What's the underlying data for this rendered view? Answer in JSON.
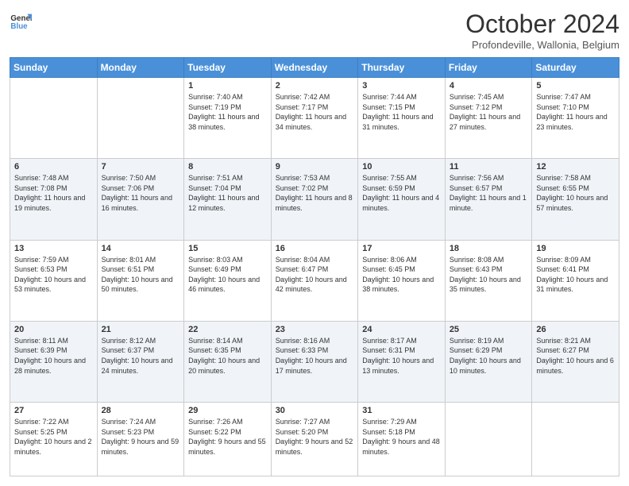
{
  "logo": {
    "text1": "General",
    "text2": "Blue"
  },
  "header": {
    "title": "October 2024",
    "subtitle": "Profondeville, Wallonia, Belgium"
  },
  "days_of_week": [
    "Sunday",
    "Monday",
    "Tuesday",
    "Wednesday",
    "Thursday",
    "Friday",
    "Saturday"
  ],
  "weeks": [
    [
      {
        "day": "",
        "info": ""
      },
      {
        "day": "",
        "info": ""
      },
      {
        "day": "1",
        "info": "Sunrise: 7:40 AM\nSunset: 7:19 PM\nDaylight: 11 hours and 38 minutes."
      },
      {
        "day": "2",
        "info": "Sunrise: 7:42 AM\nSunset: 7:17 PM\nDaylight: 11 hours and 34 minutes."
      },
      {
        "day": "3",
        "info": "Sunrise: 7:44 AM\nSunset: 7:15 PM\nDaylight: 11 hours and 31 minutes."
      },
      {
        "day": "4",
        "info": "Sunrise: 7:45 AM\nSunset: 7:12 PM\nDaylight: 11 hours and 27 minutes."
      },
      {
        "day": "5",
        "info": "Sunrise: 7:47 AM\nSunset: 7:10 PM\nDaylight: 11 hours and 23 minutes."
      }
    ],
    [
      {
        "day": "6",
        "info": "Sunrise: 7:48 AM\nSunset: 7:08 PM\nDaylight: 11 hours and 19 minutes."
      },
      {
        "day": "7",
        "info": "Sunrise: 7:50 AM\nSunset: 7:06 PM\nDaylight: 11 hours and 16 minutes."
      },
      {
        "day": "8",
        "info": "Sunrise: 7:51 AM\nSunset: 7:04 PM\nDaylight: 11 hours and 12 minutes."
      },
      {
        "day": "9",
        "info": "Sunrise: 7:53 AM\nSunset: 7:02 PM\nDaylight: 11 hours and 8 minutes."
      },
      {
        "day": "10",
        "info": "Sunrise: 7:55 AM\nSunset: 6:59 PM\nDaylight: 11 hours and 4 minutes."
      },
      {
        "day": "11",
        "info": "Sunrise: 7:56 AM\nSunset: 6:57 PM\nDaylight: 11 hours and 1 minute."
      },
      {
        "day": "12",
        "info": "Sunrise: 7:58 AM\nSunset: 6:55 PM\nDaylight: 10 hours and 57 minutes."
      }
    ],
    [
      {
        "day": "13",
        "info": "Sunrise: 7:59 AM\nSunset: 6:53 PM\nDaylight: 10 hours and 53 minutes."
      },
      {
        "day": "14",
        "info": "Sunrise: 8:01 AM\nSunset: 6:51 PM\nDaylight: 10 hours and 50 minutes."
      },
      {
        "day": "15",
        "info": "Sunrise: 8:03 AM\nSunset: 6:49 PM\nDaylight: 10 hours and 46 minutes."
      },
      {
        "day": "16",
        "info": "Sunrise: 8:04 AM\nSunset: 6:47 PM\nDaylight: 10 hours and 42 minutes."
      },
      {
        "day": "17",
        "info": "Sunrise: 8:06 AM\nSunset: 6:45 PM\nDaylight: 10 hours and 38 minutes."
      },
      {
        "day": "18",
        "info": "Sunrise: 8:08 AM\nSunset: 6:43 PM\nDaylight: 10 hours and 35 minutes."
      },
      {
        "day": "19",
        "info": "Sunrise: 8:09 AM\nSunset: 6:41 PM\nDaylight: 10 hours and 31 minutes."
      }
    ],
    [
      {
        "day": "20",
        "info": "Sunrise: 8:11 AM\nSunset: 6:39 PM\nDaylight: 10 hours and 28 minutes."
      },
      {
        "day": "21",
        "info": "Sunrise: 8:12 AM\nSunset: 6:37 PM\nDaylight: 10 hours and 24 minutes."
      },
      {
        "day": "22",
        "info": "Sunrise: 8:14 AM\nSunset: 6:35 PM\nDaylight: 10 hours and 20 minutes."
      },
      {
        "day": "23",
        "info": "Sunrise: 8:16 AM\nSunset: 6:33 PM\nDaylight: 10 hours and 17 minutes."
      },
      {
        "day": "24",
        "info": "Sunrise: 8:17 AM\nSunset: 6:31 PM\nDaylight: 10 hours and 13 minutes."
      },
      {
        "day": "25",
        "info": "Sunrise: 8:19 AM\nSunset: 6:29 PM\nDaylight: 10 hours and 10 minutes."
      },
      {
        "day": "26",
        "info": "Sunrise: 8:21 AM\nSunset: 6:27 PM\nDaylight: 10 hours and 6 minutes."
      }
    ],
    [
      {
        "day": "27",
        "info": "Sunrise: 7:22 AM\nSunset: 5:25 PM\nDaylight: 10 hours and 2 minutes."
      },
      {
        "day": "28",
        "info": "Sunrise: 7:24 AM\nSunset: 5:23 PM\nDaylight: 9 hours and 59 minutes."
      },
      {
        "day": "29",
        "info": "Sunrise: 7:26 AM\nSunset: 5:22 PM\nDaylight: 9 hours and 55 minutes."
      },
      {
        "day": "30",
        "info": "Sunrise: 7:27 AM\nSunset: 5:20 PM\nDaylight: 9 hours and 52 minutes."
      },
      {
        "day": "31",
        "info": "Sunrise: 7:29 AM\nSunset: 5:18 PM\nDaylight: 9 hours and 48 minutes."
      },
      {
        "day": "",
        "info": ""
      },
      {
        "day": "",
        "info": ""
      }
    ]
  ]
}
